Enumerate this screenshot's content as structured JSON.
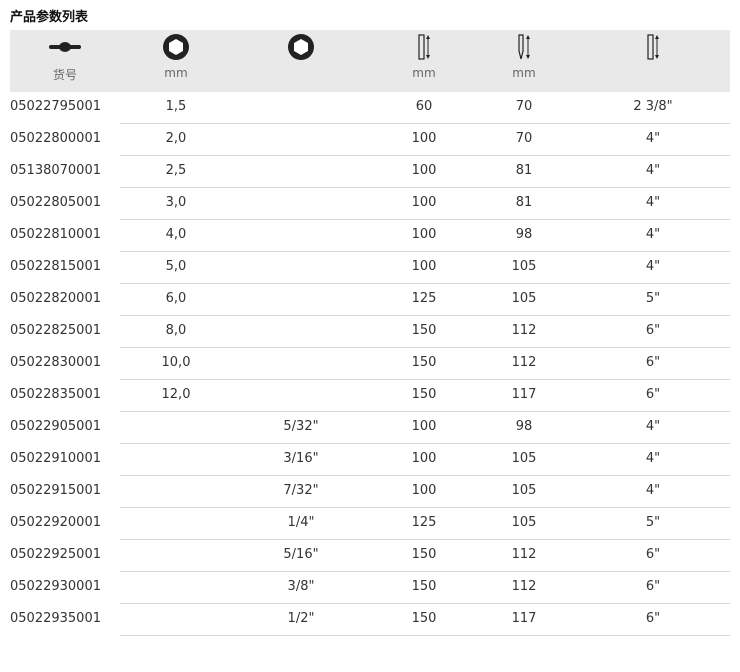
{
  "title": "产品参数列表",
  "headers": [
    {
      "icon": "bit-holder-icon",
      "label": "货号"
    },
    {
      "icon": "hex-socket-metric-icon",
      "label": "mm"
    },
    {
      "icon": "hex-socket-inch-icon",
      "label": ""
    },
    {
      "icon": "blade-length-icon",
      "label": "mm"
    },
    {
      "icon": "total-length-icon",
      "label": "mm"
    },
    {
      "icon": "blade-length-inch-icon",
      "label": ""
    }
  ],
  "rows": [
    [
      "05022795001",
      "1,5",
      "",
      "60",
      "70",
      "2 3/8\""
    ],
    [
      "05022800001",
      "2,0",
      "",
      "100",
      "70",
      "4\""
    ],
    [
      "05138070001",
      "2,5",
      "",
      "100",
      "81",
      "4\""
    ],
    [
      "05022805001",
      "3,0",
      "",
      "100",
      "81",
      "4\""
    ],
    [
      "05022810001",
      "4,0",
      "",
      "100",
      "98",
      "4\""
    ],
    [
      "05022815001",
      "5,0",
      "",
      "100",
      "105",
      "4\""
    ],
    [
      "05022820001",
      "6,0",
      "",
      "125",
      "105",
      "5\""
    ],
    [
      "05022825001",
      "8,0",
      "",
      "150",
      "112",
      "6\""
    ],
    [
      "05022830001",
      "10,0",
      "",
      "150",
      "112",
      "6\""
    ],
    [
      "05022835001",
      "12,0",
      "",
      "150",
      "117",
      "6\""
    ],
    [
      "05022905001",
      "",
      "5/32\"",
      "100",
      "98",
      "4\""
    ],
    [
      "05022910001",
      "",
      "3/16\"",
      "100",
      "105",
      "4\""
    ],
    [
      "05022915001",
      "",
      "7/32\"",
      "100",
      "105",
      "4\""
    ],
    [
      "05022920001",
      "",
      "1/4\"",
      "125",
      "105",
      "5\""
    ],
    [
      "05022925001",
      "",
      "5/16\"",
      "150",
      "112",
      "6\""
    ],
    [
      "05022930001",
      "",
      "3/8\"",
      "150",
      "112",
      "6\""
    ],
    [
      "05022935001",
      "",
      "1/2\"",
      "150",
      "117",
      "6\""
    ]
  ]
}
